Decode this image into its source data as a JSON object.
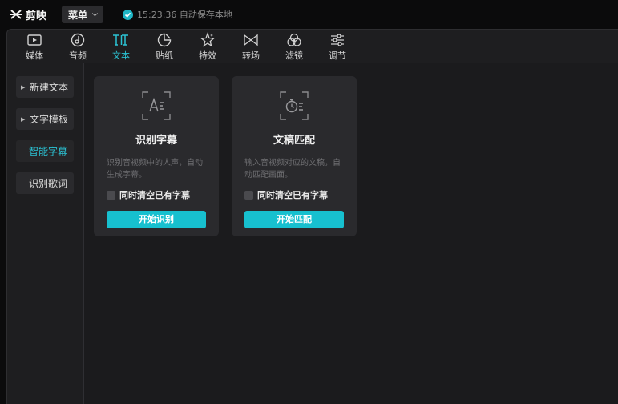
{
  "app": {
    "name": "剪映",
    "menu_label": "菜单",
    "autosave_text": "15:23:36 自动保存本地"
  },
  "toolbar": {
    "items": [
      {
        "label": "媒体",
        "icon": "media-icon"
      },
      {
        "label": "音频",
        "icon": "audio-icon"
      },
      {
        "label": "文本",
        "icon": "text-icon",
        "active": true
      },
      {
        "label": "贴纸",
        "icon": "sticker-icon"
      },
      {
        "label": "特效",
        "icon": "effects-icon"
      },
      {
        "label": "转场",
        "icon": "transition-icon"
      },
      {
        "label": "滤镜",
        "icon": "filter-icon"
      },
      {
        "label": "调节",
        "icon": "adjust-icon"
      }
    ]
  },
  "sidebar": {
    "items": [
      {
        "label": "新建文本",
        "expandable": true
      },
      {
        "label": "文字模板",
        "expandable": true
      },
      {
        "label": "智能字幕",
        "active": true
      },
      {
        "label": "识别歌词"
      }
    ]
  },
  "cards": [
    {
      "title": "识别字幕",
      "description": "识别音视频中的人声，自动生成字幕。",
      "checkbox_label": "同时清空已有字幕",
      "checkbox_checked": false,
      "button_label": "开始识别",
      "icon": "subtitle-recognition-icon"
    },
    {
      "title": "文稿匹配",
      "description": "输入音视频对应的文稿，自动匹配画面。",
      "checkbox_label": "同时清空已有字幕",
      "checkbox_checked": false,
      "button_label": "开始匹配",
      "icon": "script-match-icon"
    }
  ],
  "colors": {
    "accent": "#2bc3d4",
    "button": "#17c0cf",
    "background": "#0b0b0c",
    "panel": "#1e1e20",
    "card": "#2a2a2d"
  }
}
